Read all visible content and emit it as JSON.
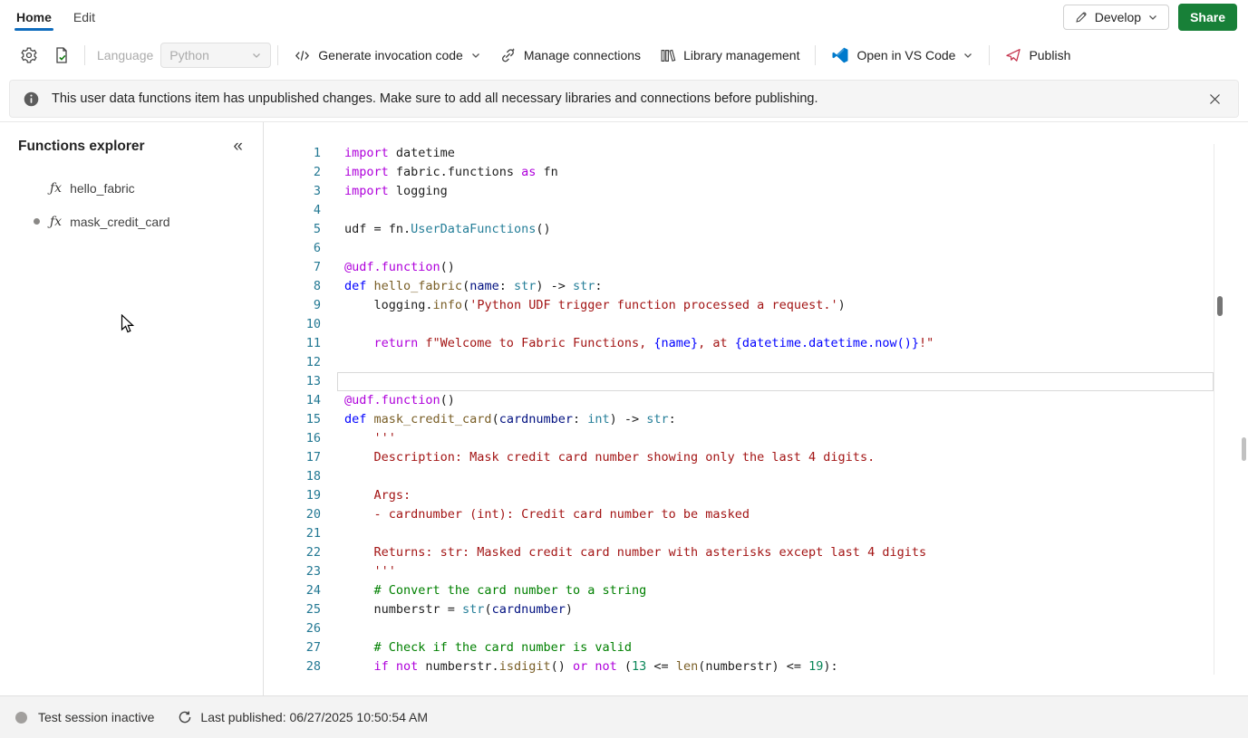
{
  "colors": {
    "tab_underline": "#0F6CBD",
    "share_button": "#188038",
    "vscode_brand": "#007ACC",
    "publish_icon": "#C4314B",
    "line_number": "#237893"
  },
  "icons": {
    "collapse_glyph": "«",
    "fx_glyph": "ƒx"
  },
  "menu": {
    "tabs": [
      {
        "label": "Home",
        "active": true
      },
      {
        "label": "Edit",
        "active": false
      }
    ],
    "develop_button": "Develop",
    "share_button": "Share"
  },
  "toolbar": {
    "language_label": "Language",
    "language_value": "Python",
    "generate_invocation_code": "Generate invocation code",
    "manage_connections": "Manage connections",
    "library_management": "Library management",
    "open_in_vs_code": "Open in VS Code",
    "publish": "Publish"
  },
  "banner": {
    "message": "This user data functions item has unpublished changes. Make sure to add all necessary libraries and connections before publishing."
  },
  "sidebar": {
    "title": "Functions explorer",
    "items": [
      {
        "label": "hello_fabric",
        "modified": false
      },
      {
        "label": "mask_credit_card",
        "modified": true
      }
    ]
  },
  "editor": {
    "lines": [
      {
        "n": 1,
        "tokens": [
          [
            "k",
            "import"
          ],
          [
            "p",
            " datetime"
          ]
        ]
      },
      {
        "n": 2,
        "tokens": [
          [
            "k",
            "import"
          ],
          [
            "p",
            " fabric.functions "
          ],
          [
            "k",
            "as"
          ],
          [
            "p",
            " fn"
          ]
        ]
      },
      {
        "n": 3,
        "tokens": [
          [
            "k",
            "import"
          ],
          [
            "p",
            " logging"
          ]
        ]
      },
      {
        "n": 4,
        "tokens": []
      },
      {
        "n": 5,
        "tokens": [
          [
            "p",
            "udf = fn."
          ],
          [
            "t",
            "UserDataFunctions"
          ],
          [
            "p",
            "()"
          ]
        ]
      },
      {
        "n": 6,
        "tokens": []
      },
      {
        "n": 7,
        "tokens": [
          [
            "d",
            "@udf.function"
          ],
          [
            "p",
            "()"
          ]
        ]
      },
      {
        "n": 8,
        "tokens": [
          [
            "b",
            "def "
          ],
          [
            "f",
            "hello_fabric"
          ],
          [
            "p",
            "("
          ],
          [
            "v",
            "name"
          ],
          [
            "p",
            ": "
          ],
          [
            "t",
            "str"
          ],
          [
            "p",
            ") -> "
          ],
          [
            "t",
            "str"
          ],
          [
            "p",
            ":"
          ]
        ]
      },
      {
        "n": 9,
        "tokens": [
          [
            "p",
            "    logging."
          ],
          [
            "f",
            "info"
          ],
          [
            "p",
            "("
          ],
          [
            "s",
            "'Python UDF trigger function processed a request.'"
          ],
          [
            "p",
            ")"
          ]
        ]
      },
      {
        "n": 10,
        "tokens": []
      },
      {
        "n": 11,
        "tokens": [
          [
            "k",
            "    return "
          ],
          [
            "s",
            "f\"Welcome to Fabric Functions, "
          ],
          [
            "i",
            "{name}"
          ],
          [
            "s",
            ", at "
          ],
          [
            "i",
            "{datetime.datetime.now()}"
          ],
          [
            "s",
            "!\""
          ]
        ]
      },
      {
        "n": 12,
        "tokens": []
      },
      {
        "n": 13,
        "tokens": [],
        "current": true
      },
      {
        "n": 14,
        "tokens": [
          [
            "d",
            "@udf.function"
          ],
          [
            "p",
            "()"
          ]
        ]
      },
      {
        "n": 15,
        "tokens": [
          [
            "b",
            "def "
          ],
          [
            "f",
            "mask_credit_card"
          ],
          [
            "p",
            "("
          ],
          [
            "v",
            "cardnumber"
          ],
          [
            "p",
            ": "
          ],
          [
            "t",
            "int"
          ],
          [
            "p",
            ") -> "
          ],
          [
            "t",
            "str"
          ],
          [
            "p",
            ":"
          ]
        ]
      },
      {
        "n": 16,
        "tokens": [
          [
            "s",
            "    '''"
          ]
        ]
      },
      {
        "n": 17,
        "tokens": [
          [
            "s",
            "    Description: Mask credit card number showing only the last 4 digits."
          ]
        ]
      },
      {
        "n": 18,
        "tokens": []
      },
      {
        "n": 19,
        "tokens": [
          [
            "s",
            "    Args:"
          ]
        ]
      },
      {
        "n": 20,
        "tokens": [
          [
            "s",
            "    - cardnumber (int): Credit card number to be masked"
          ]
        ]
      },
      {
        "n": 21,
        "tokens": []
      },
      {
        "n": 22,
        "tokens": [
          [
            "s",
            "    Returns: str: Masked credit card number with asterisks except last 4 digits"
          ]
        ]
      },
      {
        "n": 23,
        "tokens": [
          [
            "s",
            "    '''"
          ]
        ]
      },
      {
        "n": 24,
        "tokens": [
          [
            "c",
            "    # Convert the card number to a string"
          ]
        ]
      },
      {
        "n": 25,
        "tokens": [
          [
            "p",
            "    numberstr = "
          ],
          [
            "t",
            "str"
          ],
          [
            "p",
            "("
          ],
          [
            "v",
            "cardnumber"
          ],
          [
            "p",
            ")"
          ]
        ]
      },
      {
        "n": 26,
        "tokens": []
      },
      {
        "n": 27,
        "tokens": [
          [
            "c",
            "    # Check if the card number is valid"
          ]
        ]
      },
      {
        "n": 28,
        "tokens": [
          [
            "k",
            "    if not"
          ],
          [
            "p",
            " numberstr."
          ],
          [
            "f",
            "isdigit"
          ],
          [
            "p",
            "() "
          ],
          [
            "k",
            "or not"
          ],
          [
            "p",
            " ("
          ],
          [
            "n",
            "13"
          ],
          [
            "p",
            " <= "
          ],
          [
            "f",
            "len"
          ],
          [
            "p",
            "(numberstr) <= "
          ],
          [
            "n",
            "19"
          ],
          [
            "p",
            "):"
          ]
        ]
      }
    ]
  },
  "statusbar": {
    "session": "Test session inactive",
    "last_published": "Last published: 06/27/2025 10:50:54 AM"
  }
}
